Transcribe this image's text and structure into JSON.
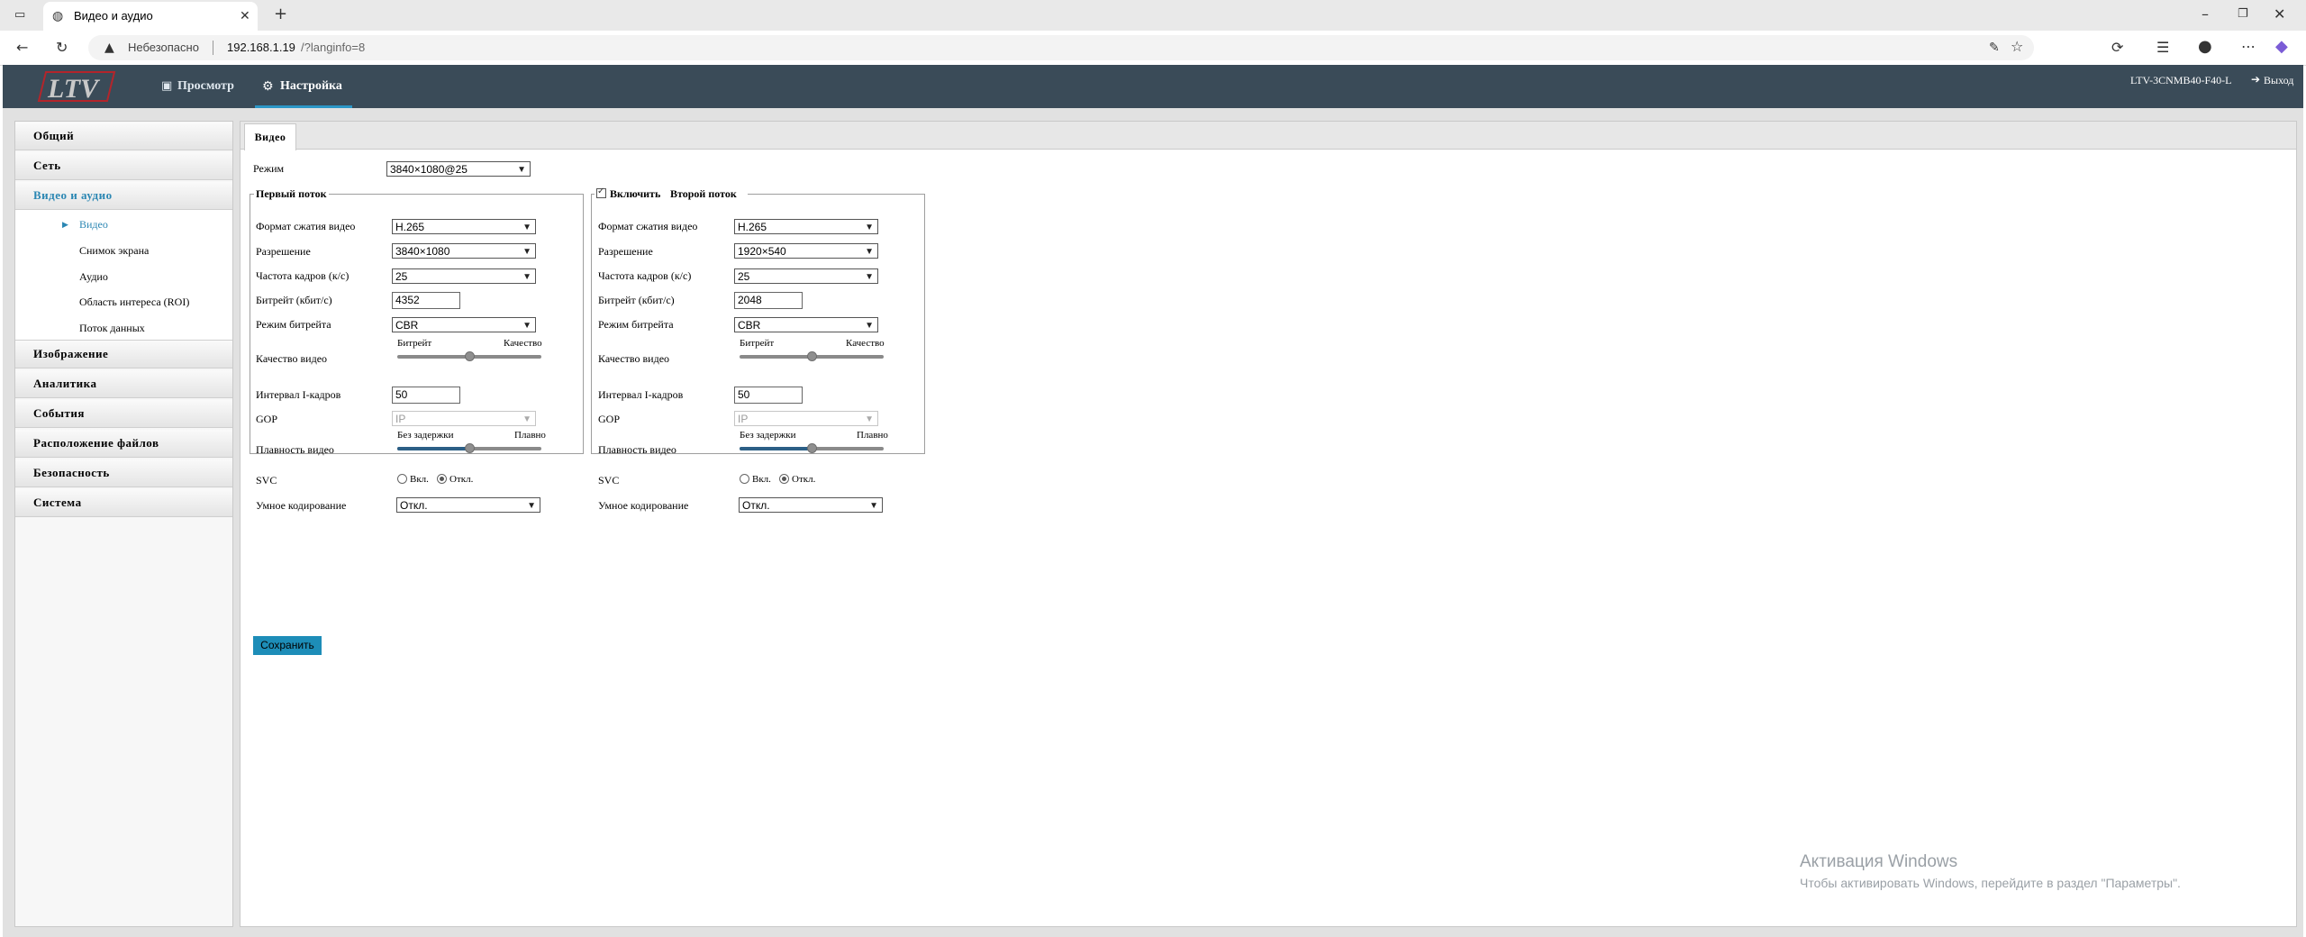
{
  "browser": {
    "tab_title": "Видео и аудио",
    "security_label": "Небезопасно",
    "url_host": "192.168.1.19",
    "url_path": "/?langinfo=8"
  },
  "header": {
    "logo_text": "LTV",
    "nav": [
      {
        "label": "Просмотр",
        "icon": "monitor-icon"
      },
      {
        "label": "Настройка",
        "icon": "gear-icon",
        "active": true
      }
    ],
    "device_model": "LTV-3CNMB40-F40-L",
    "logout_label": "Выход"
  },
  "sidebar": {
    "menu": [
      {
        "label": "Общий"
      },
      {
        "label": "Сеть"
      },
      {
        "label": "Видео и аудио",
        "active": true
      },
      {
        "label": "Изображение"
      },
      {
        "label": "Аналитика"
      },
      {
        "label": "События"
      },
      {
        "label": "Расположение файлов"
      },
      {
        "label": "Безопасность"
      },
      {
        "label": "Система"
      }
    ],
    "submenu": [
      {
        "label": "Видео",
        "active": true
      },
      {
        "label": "Снимок экрана"
      },
      {
        "label": "Аудио"
      },
      {
        "label": "Область интереса (ROI)"
      },
      {
        "label": "Поток данных"
      }
    ]
  },
  "main": {
    "tab_label": "Видео",
    "mode_label": "Режим",
    "mode_value": "3840×1080@25",
    "labels": {
      "codec": "Формат сжатия видео",
      "resolution": "Разрешение",
      "fps": "Частота кадров (к/с)",
      "bitrate": "Битрейт (кбит/с)",
      "bitrate_mode": "Режим битрейта",
      "quality": "Качество видео",
      "quality_left": "Битрейт",
      "quality_right": "Качество",
      "iframe": "Интервал I-кадров",
      "gop": "GOP",
      "smoothness": "Плавность видео",
      "smooth_left": "Без задержки",
      "smooth_right": "Плавно",
      "svc": "SVC",
      "svc_on": "Вкл.",
      "svc_off": "Откл.",
      "smart_coding": "Умное кодирование"
    },
    "stream1": {
      "title": "Первый поток",
      "codec": "H.265",
      "resolution": "3840×1080",
      "fps": "25",
      "bitrate": "4352",
      "bitrate_mode": "CBR",
      "quality_level": 0.5,
      "iframe": "50",
      "gop": "IP",
      "smoothness_level": 0.5,
      "svc": "off",
      "smart_coding": "Откл."
    },
    "stream2": {
      "title_prefix": "Включить",
      "title": "Второй поток",
      "enabled": true,
      "codec": "H.265",
      "resolution": "1920×540",
      "fps": "25",
      "bitrate": "2048",
      "bitrate_mode": "CBR",
      "quality_level": 0.5,
      "iframe": "50",
      "gop": "IP",
      "smoothness_level": 0.5,
      "svc": "off",
      "smart_coding": "Откл."
    },
    "save_label": "Сохранить"
  },
  "watermark": {
    "line1": "Активация Windows",
    "line2": "Чтобы активировать Windows, перейдите в раздел \"Параметры\"."
  }
}
